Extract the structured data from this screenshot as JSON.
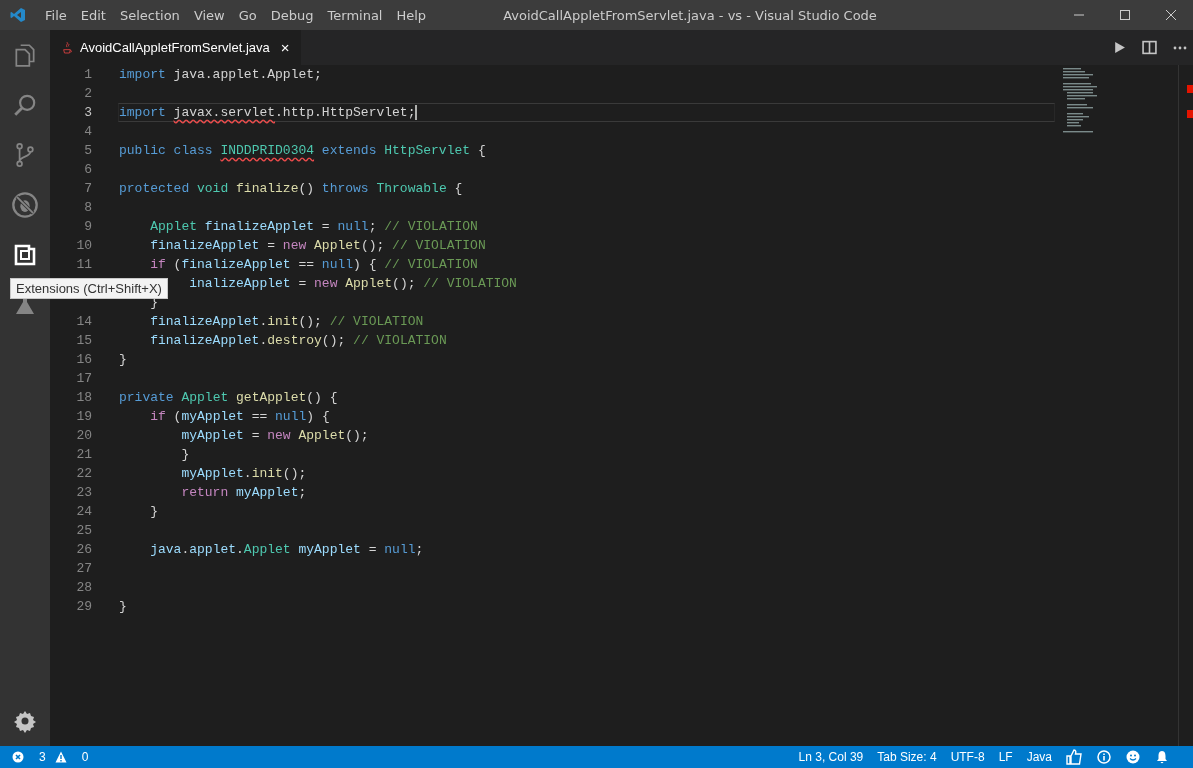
{
  "window": {
    "title": "AvoidCallAppletFromServlet.java - vs - Visual Studio Code"
  },
  "menu": [
    "File",
    "Edit",
    "Selection",
    "View",
    "Go",
    "Debug",
    "Terminal",
    "Help"
  ],
  "activity_bar": [
    {
      "kind": "files",
      "selected": false
    },
    {
      "kind": "search",
      "selected": false
    },
    {
      "kind": "source-control",
      "selected": false
    },
    {
      "kind": "debug",
      "selected": false
    },
    {
      "kind": "extensions",
      "selected": true
    },
    {
      "kind": "test",
      "selected": false
    }
  ],
  "tooltip": "Extensions (Ctrl+Shift+X)",
  "tabs": [
    {
      "label": "AvoidCallAppletFromServlet.java",
      "close": "×",
      "selected": true
    }
  ],
  "editor": {
    "lines": [
      {
        "number": "1",
        "current": false,
        "tokens": [
          {
            "kind": "keyword",
            "text": "import"
          },
          {
            "kind": "plain",
            "text": " java.applet.Applet;"
          }
        ]
      },
      {
        "number": "2",
        "current": false
      },
      {
        "number": "3",
        "current": true,
        "tokens": [
          {
            "kind": "keyword",
            "text": "import "
          },
          {
            "kind": "plain-error",
            "text": "javax.servlet"
          },
          {
            "kind": "plain",
            "text": ".http.HttpServlet;"
          }
        ]
      },
      {
        "number": "4",
        "current": false
      },
      {
        "number": "5",
        "current": false,
        "tokens": [
          {
            "kind": "keyword",
            "text": "public class "
          },
          {
            "kind": "type-error",
            "text": "INDDPRID0304"
          },
          {
            "kind": "keyword",
            "text": " extends "
          },
          {
            "kind": "type",
            "text": "HttpServlet"
          },
          {
            "kind": "plain",
            "text": " {"
          }
        ]
      },
      {
        "number": "6",
        "current": false
      },
      {
        "number": "7",
        "current": false,
        "tokens": [
          {
            "kind": "keyword",
            "text": "protected "
          },
          {
            "kind": "type",
            "text": "void "
          },
          {
            "kind": "function",
            "text": "finalize"
          },
          {
            "kind": "plain",
            "text": "() "
          },
          {
            "kind": "keyword",
            "text": "throws "
          },
          {
            "kind": "type",
            "text": "Throwable"
          },
          {
            "kind": "plain",
            "text": " {"
          }
        ]
      },
      {
        "number": "8",
        "current": false
      },
      {
        "number": "9",
        "current": false,
        "tokens": [
          {
            "kind": "type",
            "text": "    Applet "
          },
          {
            "kind": "variable",
            "text": "finalizeApplet"
          },
          {
            "kind": "plain",
            "text": " = "
          },
          {
            "kind": "keyword",
            "text": "null"
          },
          {
            "kind": "plain",
            "text": "; "
          },
          {
            "kind": "comment",
            "text": "// VIOLATION"
          }
        ]
      },
      {
        "number": "10",
        "current": false,
        "tokens": [
          {
            "kind": "variable",
            "text": "    finalizeApplet"
          },
          {
            "kind": "plain",
            "text": " = "
          },
          {
            "kind": "control",
            "text": "new "
          },
          {
            "kind": "function",
            "text": "Applet"
          },
          {
            "kind": "plain",
            "text": "(); "
          },
          {
            "kind": "comment",
            "text": "// VIOLATION"
          }
        ]
      },
      {
        "number": "11",
        "current": false,
        "tokens": [
          {
            "kind": "control",
            "text": "    if"
          },
          {
            "kind": "plain",
            "text": " ("
          },
          {
            "kind": "variable",
            "text": "finalizeApplet"
          },
          {
            "kind": "plain",
            "text": " == "
          },
          {
            "kind": "keyword",
            "text": "null"
          },
          {
            "kind": "plain",
            "text": ") { "
          },
          {
            "kind": "comment",
            "text": "// VIOLATION"
          }
        ]
      },
      {
        "current": false,
        "tokens": [
          {
            "kind": "variable",
            "text": "         inalizeApplet"
          },
          {
            "kind": "plain",
            "text": " = "
          },
          {
            "kind": "control",
            "text": "new "
          },
          {
            "kind": "function",
            "text": "Applet"
          },
          {
            "kind": "plain",
            "text": "(); "
          },
          {
            "kind": "comment",
            "text": "// VIOLATION"
          }
        ]
      },
      {
        "current": false,
        "tokens": [
          {
            "kind": "plain",
            "text": "    }"
          }
        ]
      },
      {
        "number": "14",
        "current": false,
        "tokens": [
          {
            "kind": "variable",
            "text": "    finalizeApplet"
          },
          {
            "kind": "plain",
            "text": "."
          },
          {
            "kind": "function",
            "text": "init"
          },
          {
            "kind": "plain",
            "text": "(); "
          },
          {
            "kind": "comment",
            "text": "// VIOLATION"
          }
        ]
      },
      {
        "number": "15",
        "current": false,
        "tokens": [
          {
            "kind": "variable",
            "text": "    finalizeApplet"
          },
          {
            "kind": "plain",
            "text": "."
          },
          {
            "kind": "function",
            "text": "destroy"
          },
          {
            "kind": "plain",
            "text": "(); "
          },
          {
            "kind": "comment",
            "text": "// VIOLATION"
          }
        ]
      },
      {
        "number": "16",
        "current": false,
        "tokens": [
          {
            "kind": "plain",
            "text": "}"
          }
        ]
      },
      {
        "number": "17",
        "current": false
      },
      {
        "number": "18",
        "current": false,
        "tokens": [
          {
            "kind": "keyword",
            "text": "private "
          },
          {
            "kind": "type",
            "text": "Applet "
          },
          {
            "kind": "function",
            "text": "getApplet"
          },
          {
            "kind": "plain",
            "text": "() {"
          }
        ]
      },
      {
        "number": "19",
        "current": false,
        "tokens": [
          {
            "kind": "control",
            "text": "    if"
          },
          {
            "kind": "plain",
            "text": " ("
          },
          {
            "kind": "variable",
            "text": "myApplet"
          },
          {
            "kind": "plain",
            "text": " == "
          },
          {
            "kind": "keyword",
            "text": "null"
          },
          {
            "kind": "plain",
            "text": ") {"
          }
        ]
      },
      {
        "number": "20",
        "current": false,
        "tokens": [
          {
            "kind": "variable",
            "text": "        myApplet"
          },
          {
            "kind": "plain",
            "text": " = "
          },
          {
            "kind": "control",
            "text": "new "
          },
          {
            "kind": "function",
            "text": "Applet"
          },
          {
            "kind": "plain",
            "text": "();"
          }
        ]
      },
      {
        "number": "21",
        "current": false,
        "tokens": [
          {
            "kind": "plain",
            "text": "        }"
          }
        ]
      },
      {
        "number": "22",
        "current": false,
        "tokens": [
          {
            "kind": "variable",
            "text": "        myApplet"
          },
          {
            "kind": "plain",
            "text": "."
          },
          {
            "kind": "function",
            "text": "init"
          },
          {
            "kind": "plain",
            "text": "();"
          }
        ]
      },
      {
        "number": "23",
        "current": false,
        "tokens": [
          {
            "kind": "control",
            "text": "        return "
          },
          {
            "kind": "variable",
            "text": "myApplet"
          },
          {
            "kind": "plain",
            "text": ";"
          }
        ]
      },
      {
        "number": "24",
        "current": false,
        "tokens": [
          {
            "kind": "plain",
            "text": "    }"
          }
        ]
      },
      {
        "number": "25",
        "current": false
      },
      {
        "number": "26",
        "current": false,
        "tokens": [
          {
            "kind": "variable",
            "text": "    java"
          },
          {
            "kind": "plain",
            "text": "."
          },
          {
            "kind": "variable",
            "text": "applet"
          },
          {
            "kind": "plain",
            "text": "."
          },
          {
            "kind": "type",
            "text": "Applet "
          },
          {
            "kind": "variable",
            "text": "myApplet"
          },
          {
            "kind": "plain",
            "text": " = "
          },
          {
            "kind": "keyword",
            "text": "null"
          },
          {
            "kind": "plain",
            "text": ";"
          }
        ]
      },
      {
        "number": "27",
        "current": false
      },
      {
        "number": "28",
        "current": false
      },
      {
        "number": "29",
        "current": false,
        "tokens": [
          {
            "kind": "plain",
            "text": "}"
          }
        ]
      }
    ]
  },
  "status_bar": {
    "errors": "3",
    "warnings": "0",
    "items": [
      "Ln 3, Col 39",
      "Tab Size: 4",
      "UTF-8",
      "LF",
      "Java"
    ]
  }
}
